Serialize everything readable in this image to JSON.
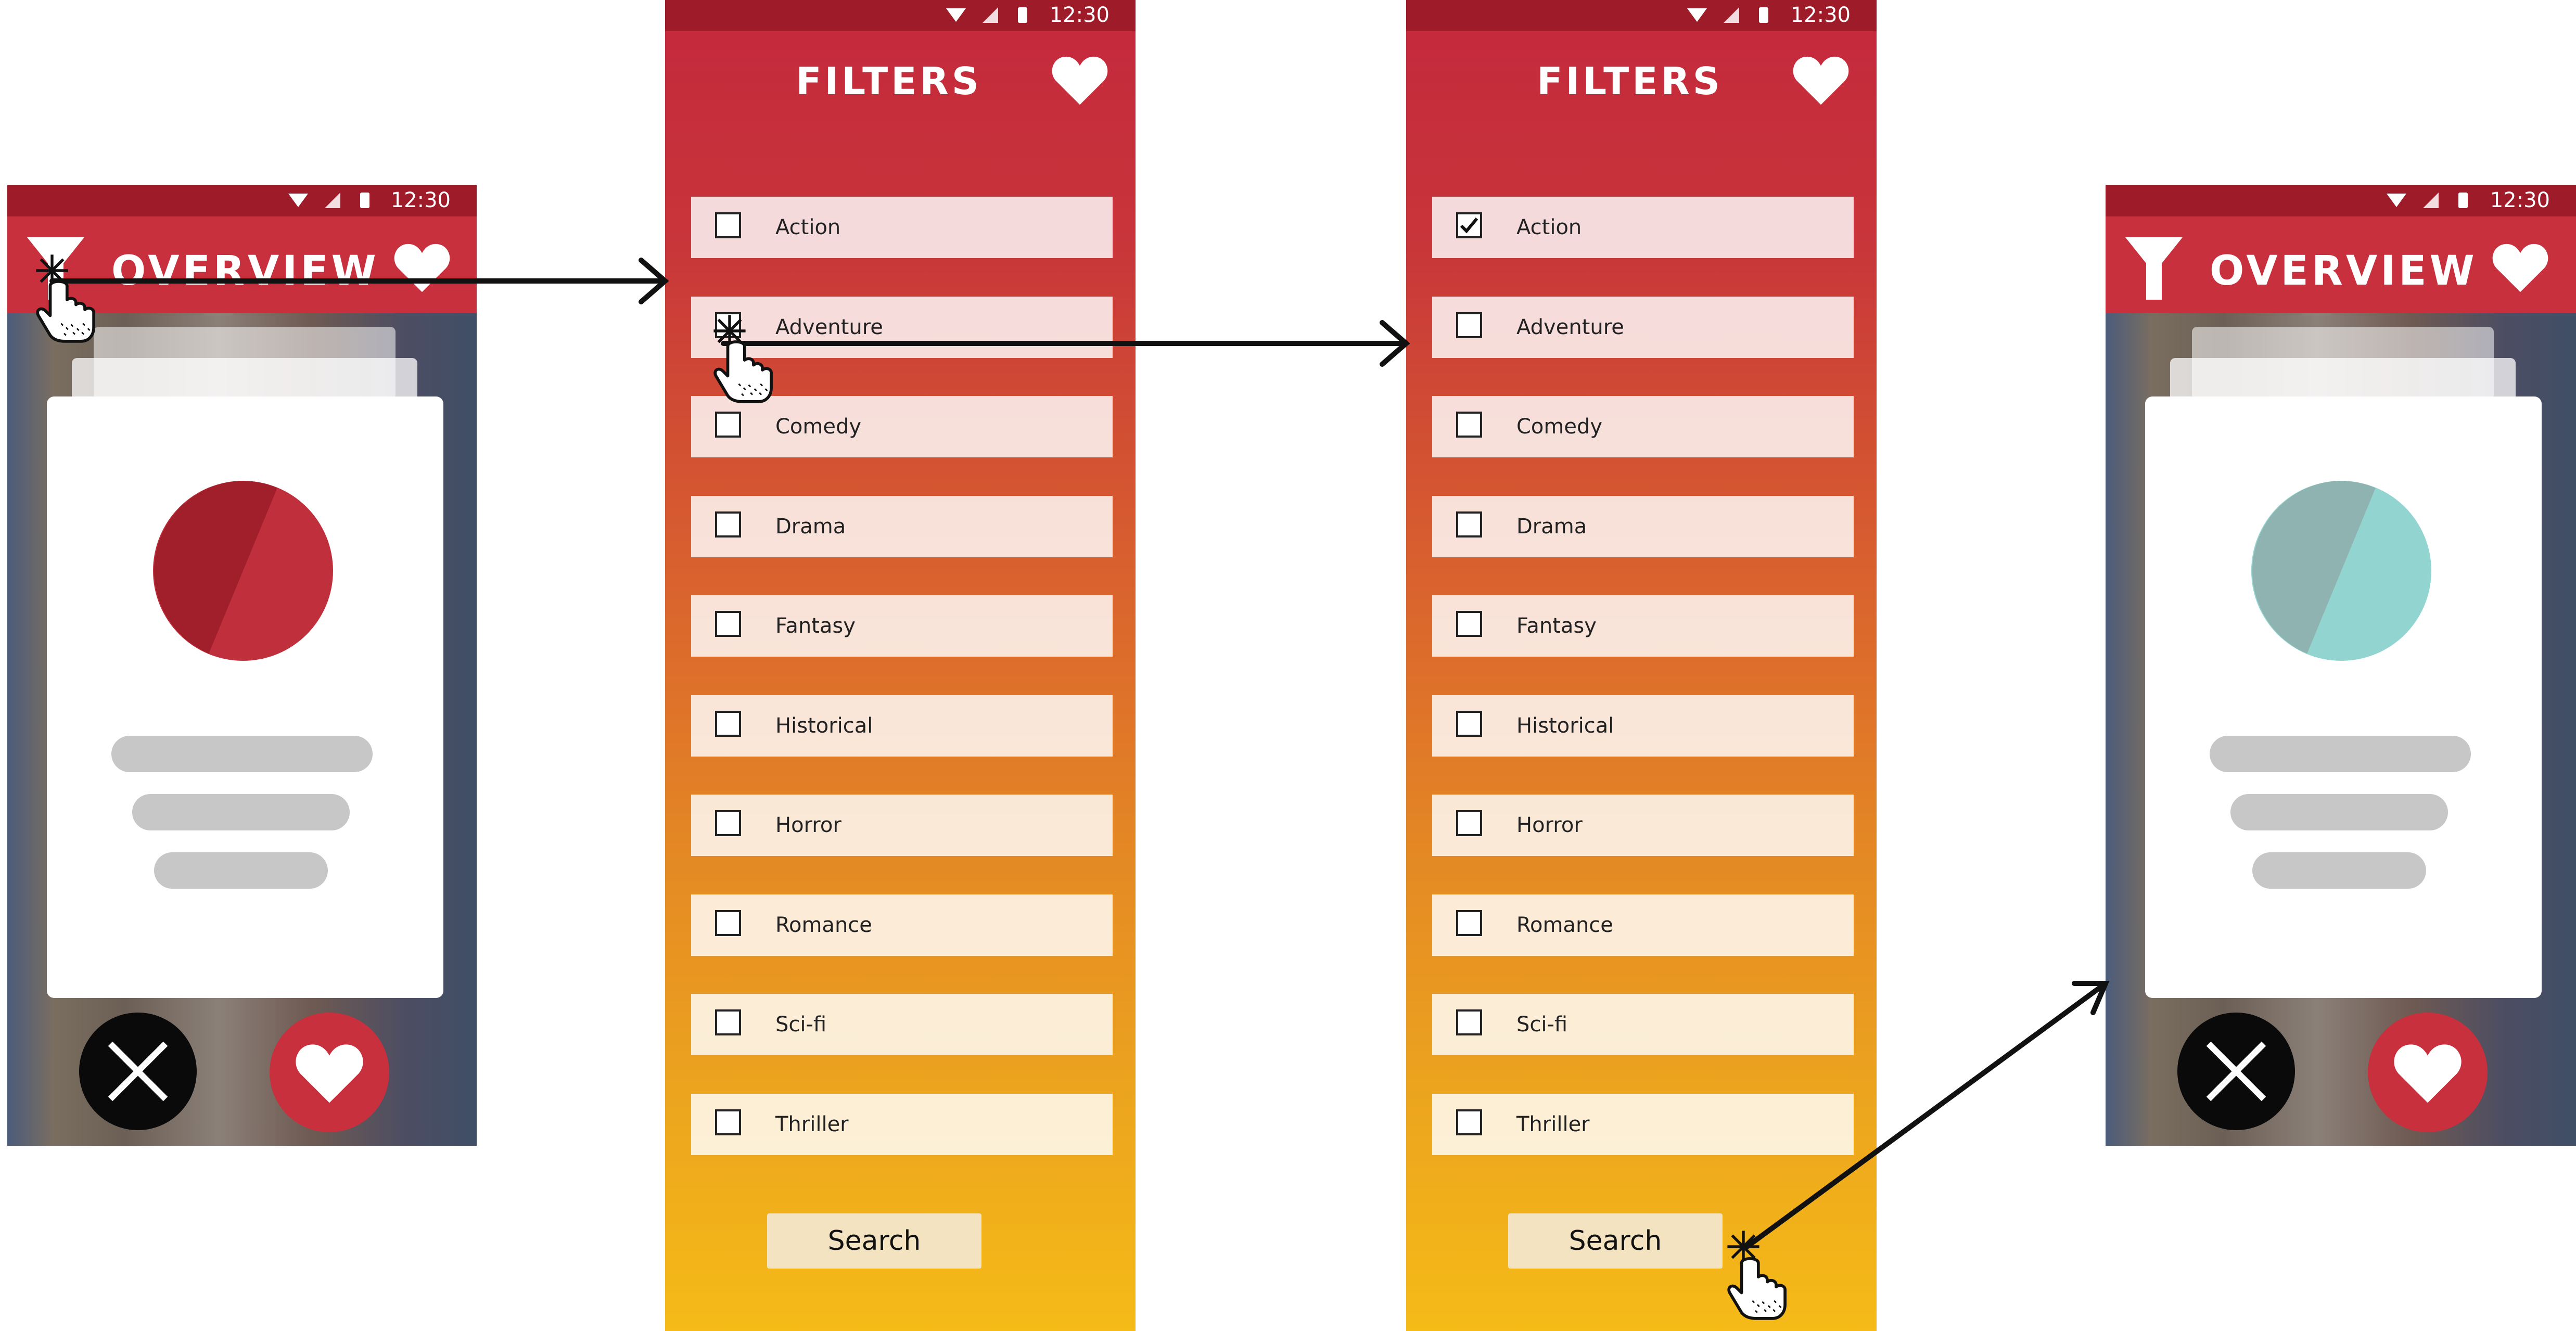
{
  "status": {
    "time": "12:30"
  },
  "overview": {
    "title": "OVERVIEW"
  },
  "filters": {
    "title": "FILTERS",
    "genres": [
      "Action",
      "Adventure",
      "Comedy",
      "Drama",
      "Fantasy",
      "Historical",
      "Horror",
      "Romance",
      "Sci-fi",
      "Thriller"
    ],
    "search_label": "Search",
    "screen2_checked": [],
    "screen3_checked": [
      "Action"
    ]
  },
  "icons": {
    "filter": "filter-funnel-icon",
    "favorites": "heart-icon",
    "dislike": "close-x-icon",
    "like": "heart-icon",
    "status": [
      "wifi-icon",
      "signal-icon",
      "battery-icon"
    ],
    "cursor": "hand-pointer-icon"
  },
  "colors": {
    "brand_red": "#c8303e",
    "status_dark": "#9e1b2a",
    "avatar_red": "#c0303c",
    "avatar_teal": "#92d4cf",
    "gradient_bottom": "#f5bb17"
  }
}
